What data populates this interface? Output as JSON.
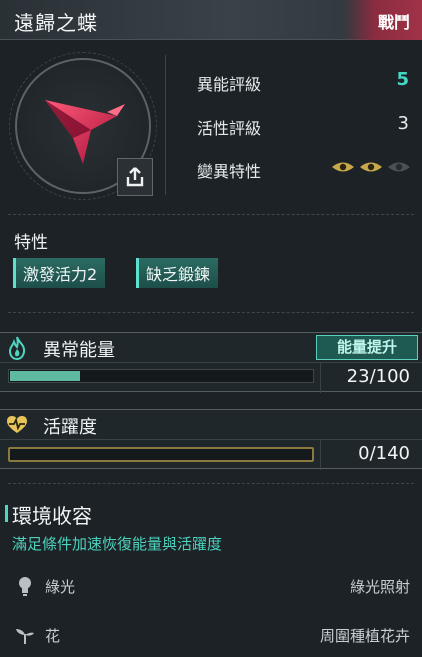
{
  "header": {
    "title": "遠歸之蝶",
    "tag": "戰鬥"
  },
  "stats": [
    {
      "label": "異能評級",
      "value": "5"
    },
    {
      "label": "活性評級",
      "value": "3"
    },
    {
      "label": "變異特性",
      "value": ""
    }
  ],
  "mutation_eyes": {
    "filled": 2,
    "total": 3
  },
  "traits": {
    "heading": "特性",
    "items": [
      "激發活力2",
      "缺乏鍛鍊"
    ]
  },
  "anomaly": {
    "name": "異常能量",
    "button": "能量提升",
    "value_text": "23/100",
    "fraction": 0.23
  },
  "activity": {
    "name": "活躍度",
    "value_text": "0/140",
    "fraction": 0.0
  },
  "environment": {
    "title": "環境收容",
    "subtitle": "滿足條件加速恢復能量與活躍度",
    "rows": [
      {
        "icon": "bulb-icon",
        "label": "綠光",
        "condition": "綠光照射"
      },
      {
        "icon": "sprout-icon",
        "label": "花",
        "condition": "周圍種植花卉"
      }
    ]
  },
  "colors": {
    "accent": "#42d8c4",
    "tag": "#a03248",
    "bar": "#5fb9a0",
    "gold": "#c8a84a"
  }
}
